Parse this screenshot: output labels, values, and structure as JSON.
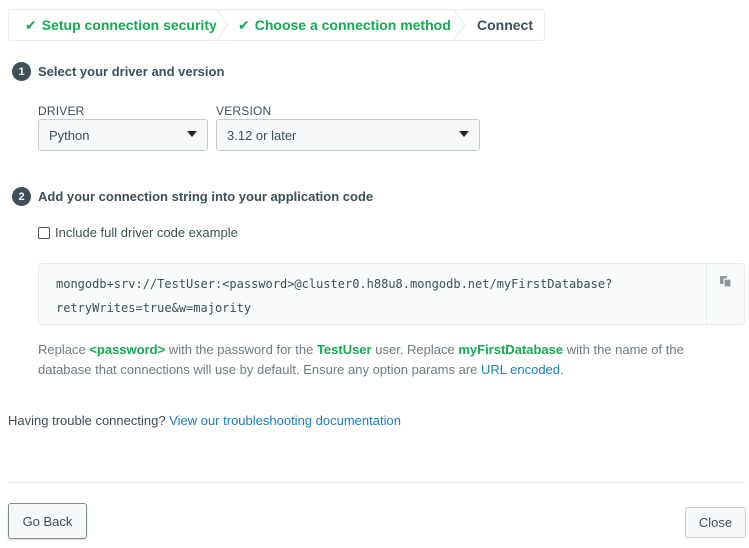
{
  "stepper": {
    "steps": [
      {
        "label": "Setup connection security",
        "status": "done"
      },
      {
        "label": "Choose a connection method",
        "status": "done"
      },
      {
        "label": "Connect",
        "status": "current"
      }
    ]
  },
  "section1": {
    "number": "1",
    "title": "Select your driver and version",
    "driver_label": "DRIVER",
    "driver_value": "Python",
    "version_label": "VERSION",
    "version_value": "3.12 or later"
  },
  "section2": {
    "number": "2",
    "title": "Add your connection string into your application code",
    "checkbox_label": "Include full driver code example",
    "checkbox_checked": false,
    "code_line1": "mongodb+srv://TestUser:<password>@cluster0.h88u8.mongodb.net/myFirstDatabase?",
    "code_line2": "retryWrites=true&w=majority",
    "copy_icon": "copy-icon"
  },
  "help": {
    "t1": "Replace ",
    "hl1": "<password>",
    "t2": " with the password for the ",
    "hl2": "TestUser",
    "t3": " user. Replace ",
    "hl3": "myFirstDatabase",
    "t4": " with the name of the database that connections will use by default. Ensure any option params are ",
    "link": "URL encoded",
    "t5": "."
  },
  "trouble": {
    "text": "Having trouble connecting? ",
    "link": "View our troubleshooting documentation"
  },
  "footer": {
    "back_label": "Go Back",
    "close_label": "Close"
  },
  "colors": {
    "accent_green": "#13aa52",
    "link_blue": "#1a7fc1",
    "text_dark": "#3d4f58"
  }
}
